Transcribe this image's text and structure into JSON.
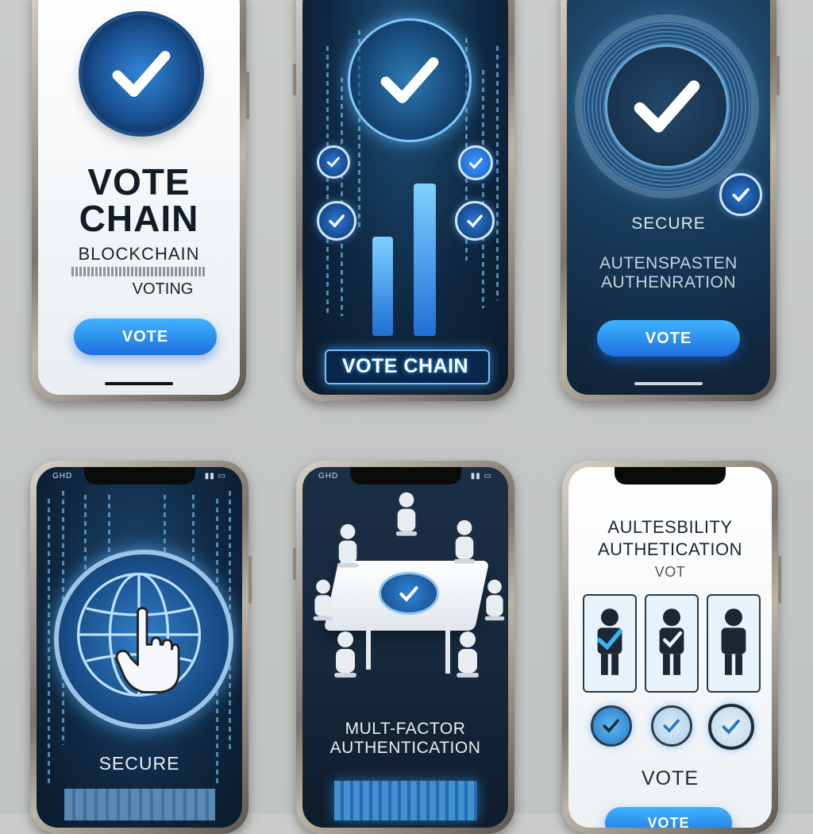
{
  "phones": {
    "p1": {
      "title_line1": "VOTE",
      "title_line2": "CHAIN",
      "subtitle_line1": "BLOCKCHAIN",
      "subtitle_line2": "VOTING",
      "button_label": "VOTE"
    },
    "p2": {
      "footer_label": "VOTE CHAIN"
    },
    "p3": {
      "heading": "SECURE",
      "subheading_line1": "AUTENSPASTEN",
      "subheading_line2": "AUTHENRATION",
      "button_label": "VOTE"
    },
    "p4": {
      "status_left": "GHD",
      "label": "SECURE"
    },
    "p5": {
      "status_left": "GHD",
      "title_line1": "MULT-FACTOR",
      "title_line2": "AUTHENTICATION"
    },
    "p6": {
      "heading_line1": "AULTESBILITY",
      "heading_line2": "AUTHETICATION",
      "heading_line3": "VOT",
      "label": "VOTE",
      "button_label": "VOTE"
    }
  },
  "colors": {
    "accent": "#1e6fe0",
    "accent_light": "#3fb4ff",
    "dark_navy": "#0f2740",
    "title_dark": "#111a24"
  },
  "icons": {
    "check": "check-icon",
    "globe": "globe-icon",
    "hand": "pointer-hand-icon",
    "person": "person-icon"
  }
}
